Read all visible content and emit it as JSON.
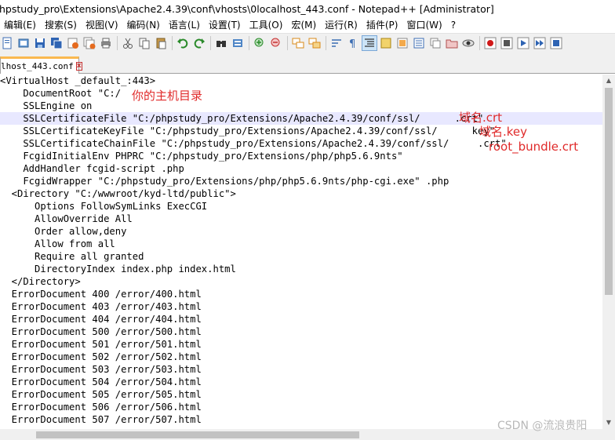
{
  "window": {
    "title": "hpstudy_pro\\Extensions\\Apache2.4.39\\conf\\vhosts\\0localhost_443.conf - Notepad++ [Administrator]"
  },
  "menu": [
    {
      "label": "编辑(E)"
    },
    {
      "label": "搜索(S)"
    },
    {
      "label": "视图(V)"
    },
    {
      "label": "编码(N)"
    },
    {
      "label": "语言(L)"
    },
    {
      "label": "设置(T)"
    },
    {
      "label": "工具(O)"
    },
    {
      "label": "宏(M)"
    },
    {
      "label": "运行(R)"
    },
    {
      "label": "插件(P)"
    },
    {
      "label": "窗口(W)"
    },
    {
      "label": "?"
    }
  ],
  "tab": {
    "label": "lhost_443.conf",
    "close": "x"
  },
  "code": [
    "<VirtualHost _default_:443>",
    "    DocumentRoot \"C:/",
    "    SSLEngine on",
    "    SSLCertificateFile \"C:/phpstudy_pro/Extensions/Apache2.4.39/conf/ssl/      .crt\"",
    "    SSLCertificateKeyFile \"C:/phpstudy_pro/Extensions/Apache2.4.39/conf/ssl/      key\"",
    "    SSLCertificateChainFile \"C:/phpstudy_pro/Extensions/Apache2.4.39/conf/ssl/     .crt\"",
    "    FcgidInitialEnv PHPRC \"C:/phpstudy_pro/Extensions/php/php5.6.9nts\"",
    "    AddHandler fcgid-script .php",
    "    FcgidWrapper \"C:/phpstudy_pro/Extensions/php/php5.6.9nts/php-cgi.exe\" .php",
    "  <Directory \"C:/wwwroot/kyd-ltd/public\">",
    "      Options FollowSymLinks ExecCGI",
    "      AllowOverride All",
    "      Order allow,deny",
    "      Allow from all",
    "      Require all granted",
    "      DirectoryIndex index.php index.html",
    "  </Directory>",
    "  ErrorDocument 400 /error/400.html",
    "  ErrorDocument 403 /error/403.html",
    "  ErrorDocument 404 /error/404.html",
    "  ErrorDocument 500 /error/500.html",
    "  ErrorDocument 501 /error/501.html",
    "  ErrorDocument 502 /error/502.html",
    "  ErrorDocument 503 /error/503.html",
    "  ErrorDocument 504 /error/504.html",
    "  ErrorDocument 505 /error/505.html",
    "  ErrorDocument 506 /error/506.html",
    "  ErrorDocument 507 /error/507.html"
  ],
  "annotations": {
    "root_dir": "你的主机目录",
    "crt": "域名.crt",
    "key": "域名.key",
    "chain": "root_bundle.crt"
  },
  "watermark": "CSDN @流浪贵阳",
  "toolbar_icons": [
    "new-file-icon",
    "open-file-icon",
    "save-icon",
    "save-all-icon",
    "close-icon",
    "close-all-icon",
    "print-icon",
    "cut-icon",
    "copy-icon",
    "paste-icon",
    "undo-icon",
    "redo-icon",
    "find-icon",
    "replace-icon",
    "zoom-in-icon",
    "zoom-out-icon",
    "sync-vertical-icon",
    "sync-horizontal-icon",
    "word-wrap-icon",
    "show-all-chars-icon",
    "indent-guide-icon",
    "lang-define-icon",
    "doc-map-icon",
    "function-list-icon",
    "folder-workspace-icon",
    "monitor-icon",
    "record-macro-icon",
    "stop-macro-icon",
    "play-macro-icon",
    "run-macro-multiple-icon",
    "save-macro-icon"
  ]
}
